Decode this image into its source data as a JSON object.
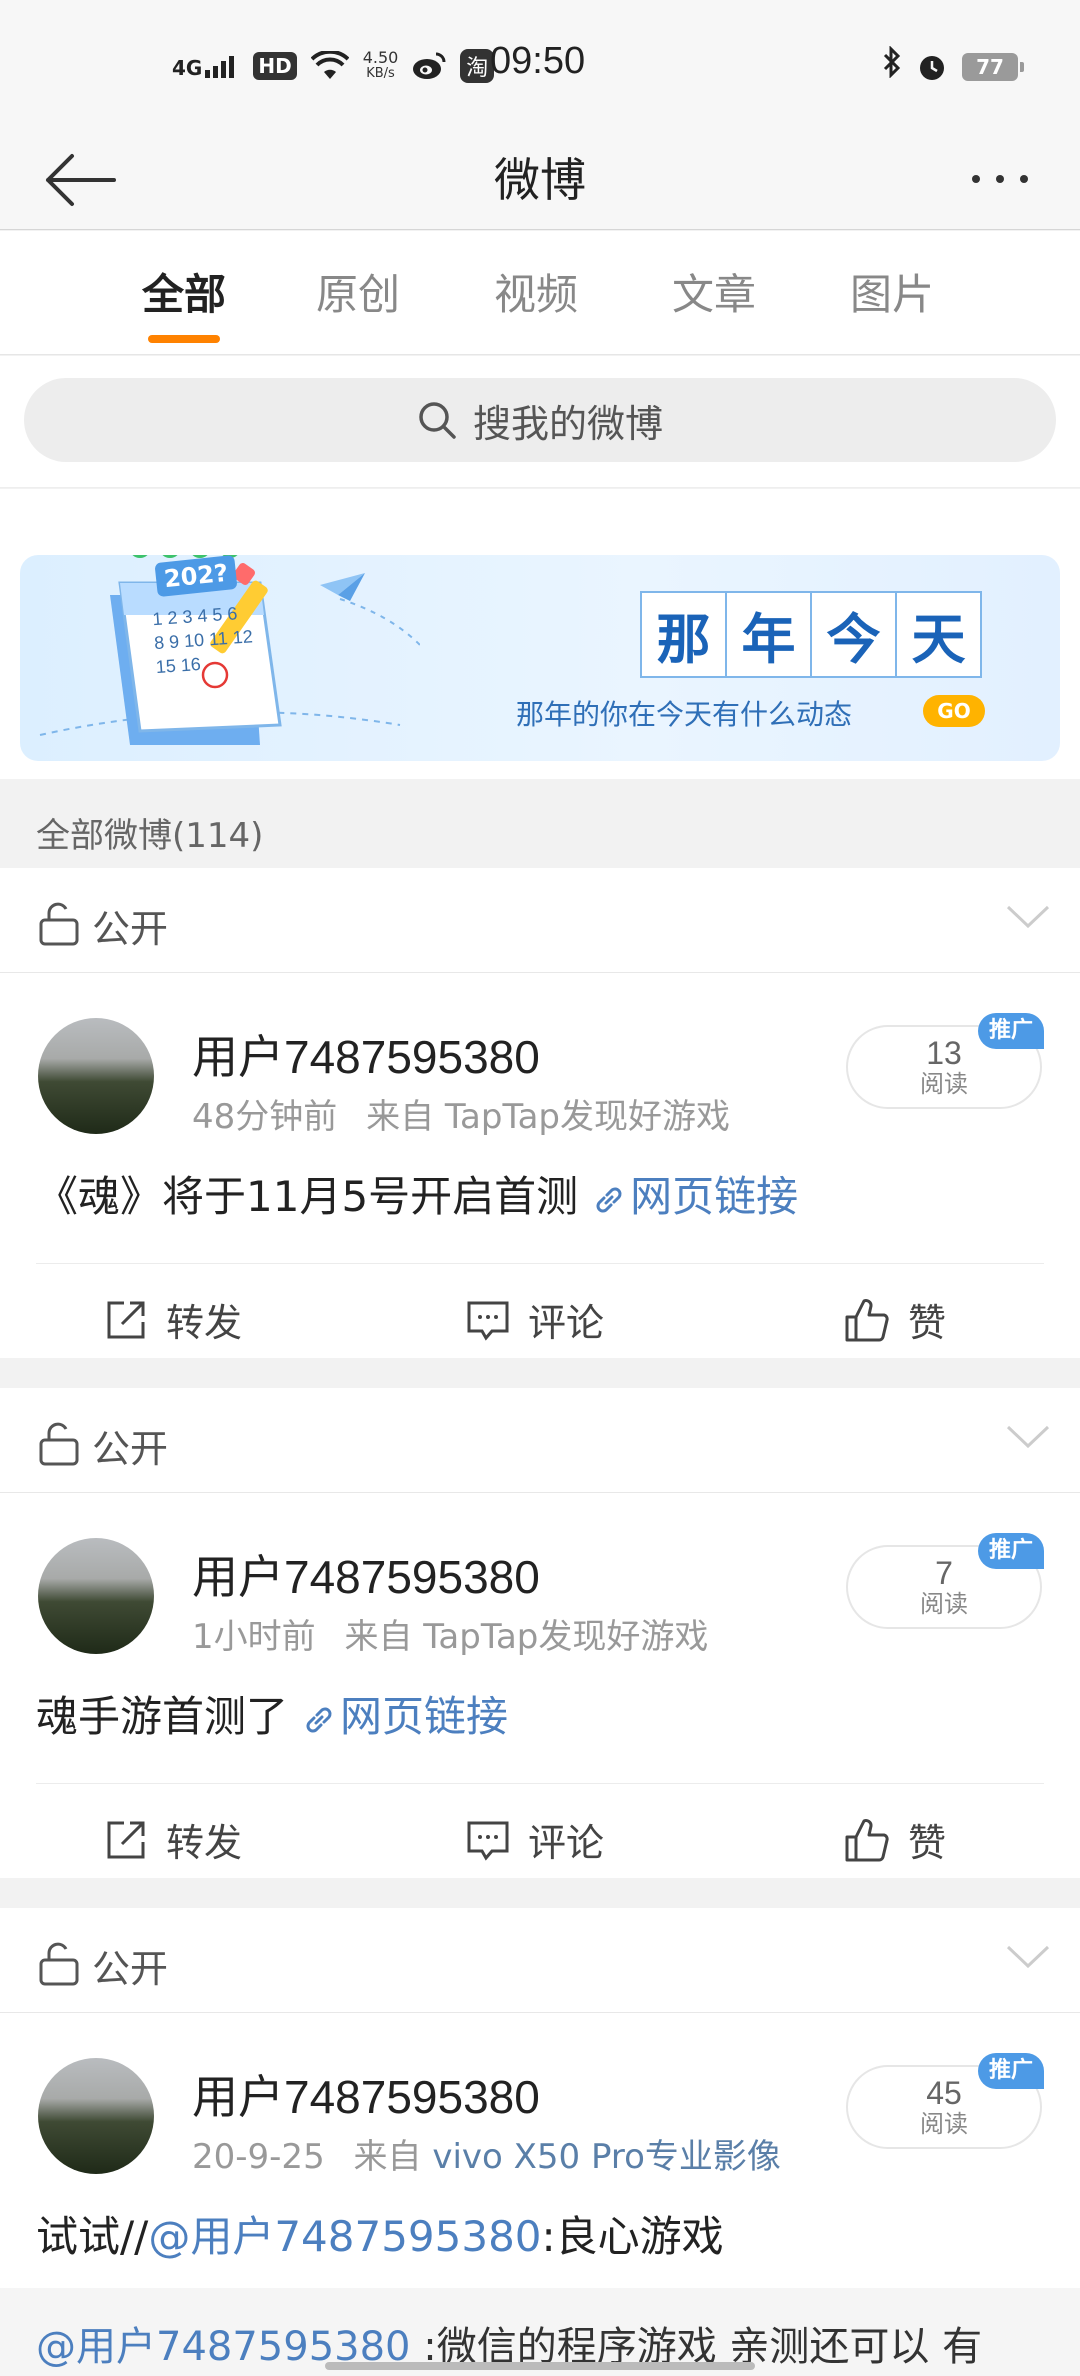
{
  "status_bar": {
    "network": "4G",
    "hd": "HD",
    "speed_value": "4.50",
    "speed_unit": "KB/s",
    "taobao_icon_char": "淘",
    "time": "09:50",
    "battery": "77"
  },
  "header": {
    "title": "微博"
  },
  "tabs": [
    {
      "label": "全部",
      "active": true
    },
    {
      "label": "原创",
      "active": false
    },
    {
      "label": "视频",
      "active": false
    },
    {
      "label": "文章",
      "active": false
    },
    {
      "label": "图片",
      "active": false
    }
  ],
  "search": {
    "placeholder": "搜我的微博"
  },
  "banner": {
    "calendar_year": "202?",
    "title_chars": [
      "那",
      "年",
      "今",
      "天"
    ],
    "subtitle": "那年的你在今天有什么动态",
    "go": "GO"
  },
  "count_bar": {
    "text": "全部微博(114)"
  },
  "posts": [
    {
      "visibility": "公开",
      "username": "用户7487595380",
      "time": "48分钟前",
      "source_prefix": "来自",
      "source": "TapTap发现好游戏",
      "read_count": "13",
      "read_label": "阅读",
      "promo": "推广",
      "text": "《魂》将于11月5号开启首测",
      "link_text": "网页链接",
      "actions": {
        "repost": "转发",
        "comment": "评论",
        "like": "赞"
      }
    },
    {
      "visibility": "公开",
      "username": "用户7487595380",
      "time": "1小时前",
      "source_prefix": "来自",
      "source": "TapTap发现好游戏",
      "read_count": "7",
      "read_label": "阅读",
      "promo": "推广",
      "text": "魂手游首测了",
      "link_text": "网页链接",
      "actions": {
        "repost": "转发",
        "comment": "评论",
        "like": "赞"
      }
    },
    {
      "visibility": "公开",
      "username": "用户7487595380",
      "time": "20-9-25",
      "source_prefix": "来自",
      "source": "vivo X50 Pro专业影像",
      "read_count": "45",
      "read_label": "阅读",
      "promo": "推广",
      "text_prefix": "试试//",
      "mention": "@用户7487595380",
      "text_suffix": ":良心游戏",
      "quote_mention": "@用户7487595380",
      "quote_text": " :微信的程序游戏  亲测还可以  有"
    }
  ],
  "colors": {
    "accent_orange": "#ff8200",
    "link_blue": "#4c7fbf",
    "promo_blue": "#4d9ae6"
  }
}
